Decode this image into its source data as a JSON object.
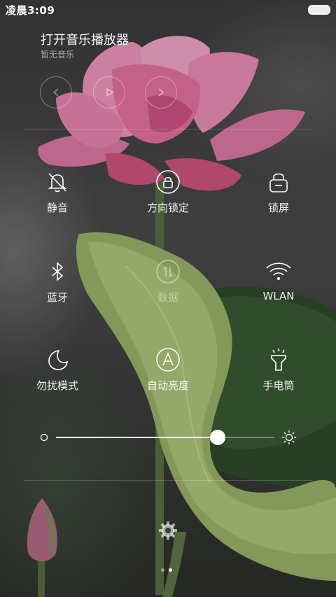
{
  "status_bar": {
    "time": "凌晨3:09",
    "battery_icon": "battery-icon"
  },
  "music": {
    "title": "打开音乐播放器",
    "subtitle": "暂无音乐",
    "controls": [
      "previous-icon",
      "play-icon",
      "next-icon"
    ]
  },
  "toggles": [
    {
      "label": "静音",
      "icon": "bell-off-icon",
      "enabled": true
    },
    {
      "label": "方向锁定",
      "icon": "rotation-lock-icon",
      "enabled": true
    },
    {
      "label": "锁屏",
      "icon": "lock-icon",
      "enabled": true
    },
    {
      "label": "蓝牙",
      "icon": "bluetooth-icon",
      "enabled": true
    },
    {
      "label": "数据",
      "icon": "data-arrows-icon",
      "enabled": false
    },
    {
      "label": "WLAN",
      "icon": "wifi-icon",
      "enabled": true
    },
    {
      "label": "勿扰模式",
      "icon": "moon-icon",
      "enabled": true
    },
    {
      "label": "自动亮度",
      "icon": "auto-brightness-icon",
      "enabled": true
    },
    {
      "label": "手电筒",
      "icon": "flashlight-icon",
      "enabled": true
    }
  ],
  "brightness": {
    "level": 0.74,
    "min_icon": "brightness-low-icon",
    "max_icon": "brightness-high-icon"
  },
  "settings_icon": "gear-icon",
  "pager": {
    "pages": 2,
    "current": 2
  }
}
